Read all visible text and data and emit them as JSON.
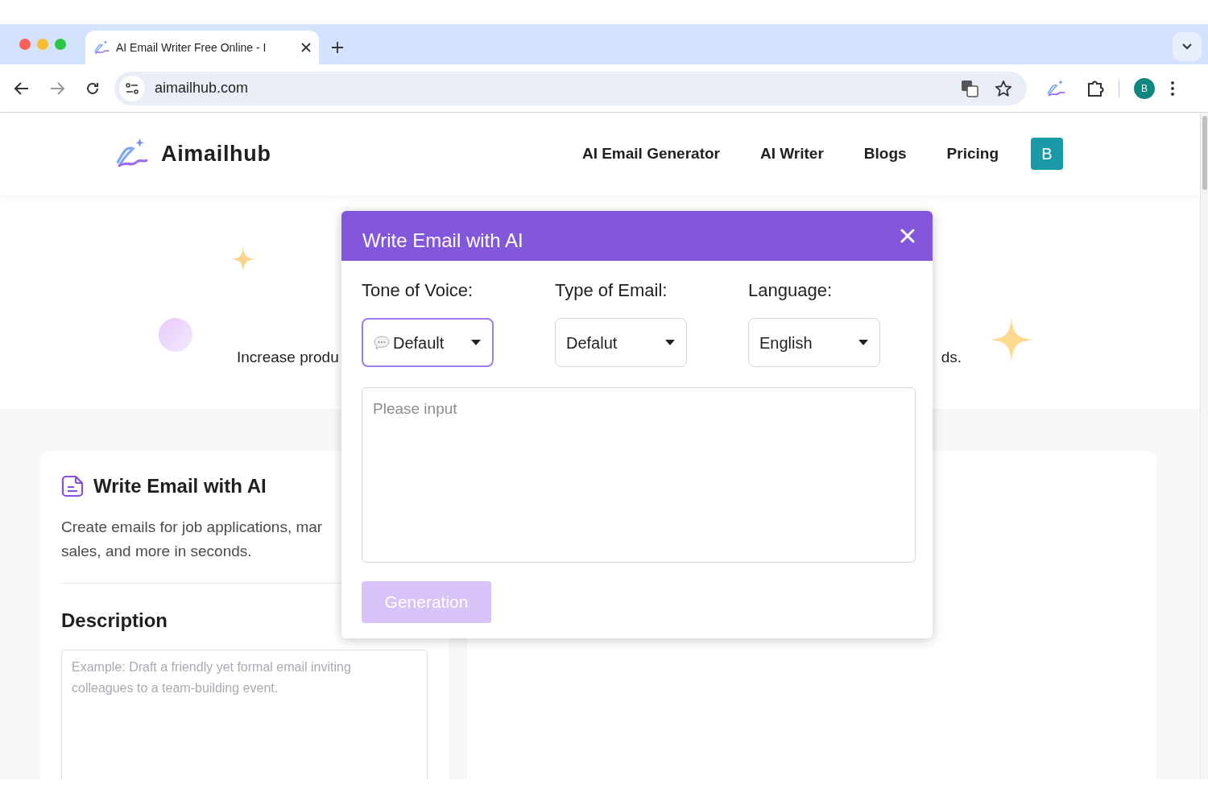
{
  "browser": {
    "tab_title": "AI Email Writer Free Online - I",
    "address": "aimailhub.com",
    "profile": "B"
  },
  "site": {
    "logo": "Aimailhub",
    "nav": [
      "AI Email Generator",
      "AI Writer",
      "Blogs",
      "Pricing"
    ],
    "avatar": "B"
  },
  "hero": {
    "text_left": "Increase produ",
    "text_right": "ds."
  },
  "card": {
    "title": "Write Email with AI",
    "description_lines": [
      "Create emails for job applications, mar",
      "sales, and more in seconds."
    ],
    "section": "Description",
    "placeholder": "Example: Draft a friendly yet formal email inviting colleagues to a team-building event."
  },
  "modal": {
    "title": "Write Email with AI",
    "fields": [
      {
        "label": "Tone of Voice:",
        "value": "Default",
        "focused": true,
        "icon": true
      },
      {
        "label": "Type of Email:",
        "value": "Defalut",
        "focused": false,
        "icon": false
      },
      {
        "label": "Language:",
        "value": "English",
        "focused": false,
        "icon": false
      }
    ],
    "placeholder": "Please input",
    "button": "Generation",
    "button_disabled": true
  }
}
